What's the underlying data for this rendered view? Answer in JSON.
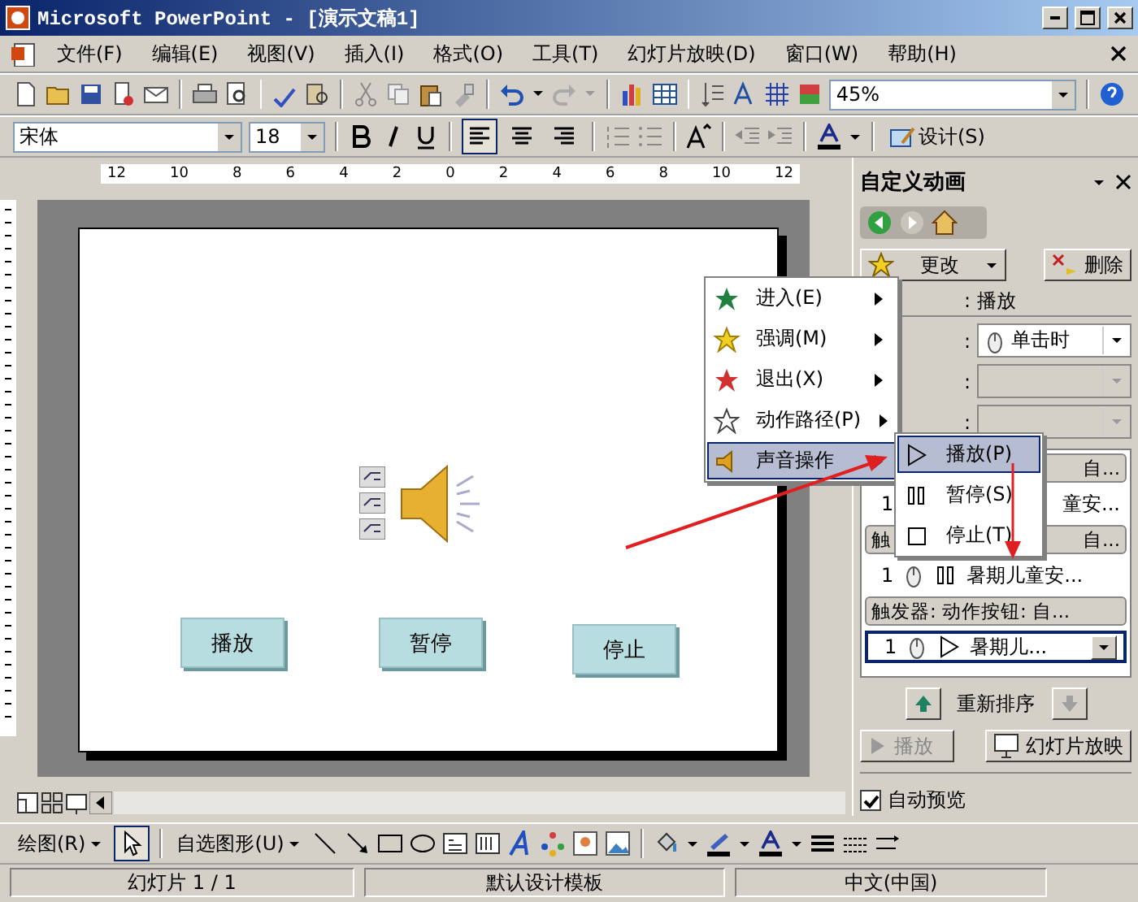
{
  "window": {
    "title": "Microsoft PowerPoint - [演示文稿1]"
  },
  "menu_bar": {
    "items": [
      "文件(F)",
      "编辑(E)",
      "视图(V)",
      "插入(I)",
      "格式(O)",
      "工具(T)",
      "幻灯片放映(D)",
      "窗口(W)",
      "帮助(H)"
    ]
  },
  "standard_toolbar": {
    "zoom": "45%"
  },
  "formatting_toolbar": {
    "font": "宋体",
    "size": "18",
    "alignment": [
      {
        "selected": true
      },
      {
        "selected": false
      },
      {
        "selected": false
      }
    ],
    "design_button": "设计(S)"
  },
  "ruler": {
    "labels": [
      "12",
      "10",
      "8",
      "6",
      "4",
      "2",
      "0",
      "2",
      "4",
      "6",
      "8",
      "10",
      "12"
    ]
  },
  "slide": {
    "buttons": [
      {
        "label": "播放"
      },
      {
        "label": "暂停"
      },
      {
        "label": "停止"
      }
    ]
  },
  "task_pane": {
    "title": "自定义动画",
    "change_button": "更改",
    "delete_button": "删除",
    "modify_label": ": 播放",
    "property_rows": [
      {
        "label": ":",
        "value": "单击时",
        "disabled": false
      },
      {
        "label": ":",
        "disabled": true
      },
      {
        "label": ":",
        "disabled": true
      }
    ],
    "animation_list": [
      {
        "kind": "header",
        "tail": "自..."
      },
      {
        "kind": "fragment",
        "number": "1",
        "tail": "童安..."
      },
      {
        "kind": "header",
        "lead": "触",
        "tail": "自..."
      },
      {
        "kind": "pause",
        "number": "1",
        "text": "暑期儿童安...",
        "selected": false
      },
      {
        "kind": "header",
        "lead": "触发器: 动作按钮: 自..."
      },
      {
        "kind": "play",
        "number": "1",
        "text": "暑期儿...",
        "selected": true
      }
    ],
    "reorder_label": "重新排序",
    "play_button": {
      "label": "播放",
      "disabled": true
    },
    "slideshow_button": "幻灯片放映",
    "auto_preview": {
      "label": "自动预览",
      "checked": true
    }
  },
  "context_menu": {
    "items": [
      {
        "label": "进入(E)",
        "kind": "entrance",
        "selected": false
      },
      {
        "label": "强调(M)",
        "kind": "emphasis",
        "selected": false
      },
      {
        "label": "退出(X)",
        "kind": "exit",
        "selected": false
      },
      {
        "label": "动作路径(P)",
        "kind": "path",
        "selected": false
      },
      {
        "label": "声音操作",
        "kind": "sound",
        "selected": true
      }
    ]
  },
  "submenu": {
    "items": [
      {
        "label": "播放(P)",
        "kind": "play",
        "selected": true
      },
      {
        "label": "暂停(S)",
        "kind": "pause",
        "selected": false
      },
      {
        "label": "停止(T)",
        "kind": "stop",
        "selected": false
      }
    ]
  },
  "drawing_toolbar": {
    "draw_menu": "绘图(R)",
    "autoshapes_menu": "自选图形(U)",
    "select_tool": {
      "selected": true
    }
  },
  "status_bar": [
    "幻灯片 1 / 1",
    "默认设计模板",
    "中文(中国)"
  ]
}
